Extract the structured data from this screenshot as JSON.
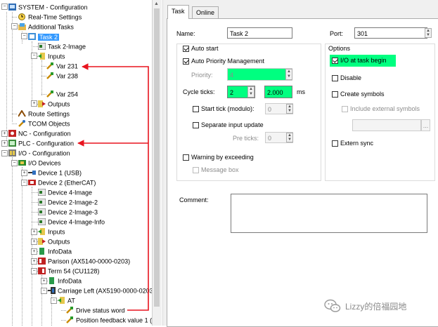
{
  "tree": {
    "system": "SYSTEM - Configuration",
    "realtime": "Real-Time Settings",
    "additional_tasks": "Additional Tasks",
    "task2": "Task 2",
    "task2_image": "Task 2-Image",
    "inputs": "Inputs",
    "var231": "Var 231",
    "var238": "Var 238",
    "var254": "Var 254",
    "outputs": "Outputs",
    "route_settings": "Route Settings",
    "tcom": "TCOM Objects",
    "nc": "NC - Configuration",
    "plc": "PLC - Configuration",
    "io": "I/O - Configuration",
    "io_devices": "I/O Devices",
    "device1": "Device 1 (USB)",
    "device2": "Device 2 (EtherCAT)",
    "device4_image": "Device 4-Image",
    "device2_image2": "Device 2-Image-2",
    "device2_image3": "Device 2-Image-3",
    "device4_image_info": "Device 4-Image-Info",
    "inputs2": "Inputs",
    "outputs2": "Outputs",
    "infodata": "InfoData",
    "parison": "Parison (AX5140-0000-0203)",
    "term54": "Term 54 (CU1128)",
    "infodata2": "InfoData",
    "carriage": "Carriage Left (AX5190-0000-0203",
    "at": "AT",
    "drive_status": "Drive status word",
    "position_feedback": "Position feedback value 1 ("
  },
  "tabs": {
    "task": "Task",
    "online": "Online"
  },
  "form": {
    "name_label": "Name:",
    "name_value": "Task 2",
    "port_label": "Port:",
    "port_value": "301",
    "auto_start": "Auto start",
    "auto_priority": "Auto Priority Management",
    "priority_label": "Priority:",
    "priority_value": "4",
    "cycle_label": "Cycle ticks:",
    "cycle_value": "2",
    "cycle_ms_value": "2.000",
    "ms": "ms",
    "start_tick": "Start tick (modulo):",
    "start_tick_value": "0",
    "separate_input": "Separate input update",
    "pre_ticks": "Pre ticks:",
    "pre_ticks_value": "0",
    "warning": "Warning by exceeding",
    "message_box": "Message box",
    "comment_label": "Comment:",
    "comment_value": ""
  },
  "options": {
    "title": "Options",
    "io_at_task_begin": "I/O at task begin",
    "disable": "Disable",
    "create_symbols": "Create symbols",
    "include_external": "Include external symbols",
    "extern_sync": "Extern sync",
    "browse": "..."
  },
  "watermark": {
    "text": "Lizzy的倍福园地"
  },
  "colors": {
    "highlight": "#00ff80",
    "arrow": "#e8141e",
    "selection": "#3399ff"
  }
}
